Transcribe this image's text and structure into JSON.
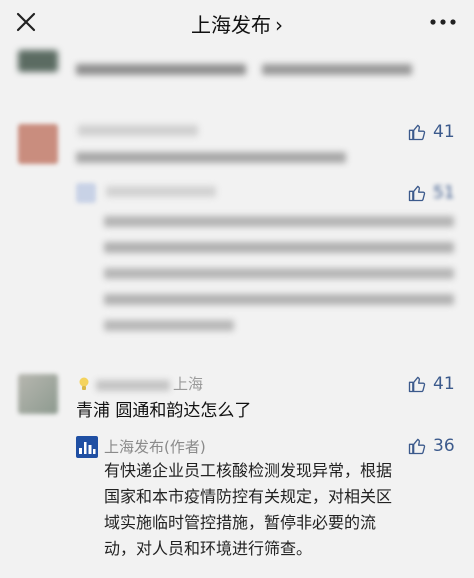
{
  "header": {
    "title": "上海发布",
    "chevron": "›"
  },
  "comments": [
    {
      "author_suffix": "上海",
      "likes": "41",
      "text": "青浦 圆通和韵达怎么了",
      "reply": {
        "author": "上海发布(作者)",
        "likes": "36",
        "lines": [
          "有快递企业员工核酸检测发现异常，根据",
          "国家和本市疫情防控有关规定，对相关区",
          "域实施临时管控措施，暂停非必要的流",
          "动，对人员和环境进行筛查。"
        ]
      }
    }
  ],
  "blurred_comment": {
    "likes": "41",
    "reply_likes": "51"
  },
  "colors": {
    "background": "#f2f2f2",
    "like_blue": "#3c5a8c",
    "name_gray": "#8a8a8a"
  }
}
